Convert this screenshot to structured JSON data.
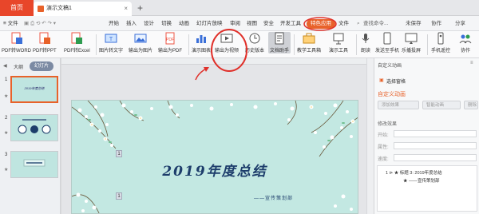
{
  "tabs": {
    "home": "首页",
    "document": "演示文稿1",
    "close": "×",
    "add": "+"
  },
  "menu": {
    "file": "≡ 文件",
    "items": [
      "开始",
      "插入",
      "设计",
      "切换",
      "动画",
      "幻灯片放映",
      "审阅",
      "视图",
      "安全",
      "开发工具"
    ],
    "highlight": "特色应用",
    "after": "文件",
    "search": "查找命令...",
    "unsaved": "未保存",
    "collab": "协作",
    "share": "分享"
  },
  "ribbon": {
    "items": [
      {
        "label": "PDF转WORD",
        "icon": "pdf-to-word-icon"
      },
      {
        "label": "PDF转PPT",
        "icon": "pdf-to-ppt-icon"
      },
      {
        "label": "PDF转Excel",
        "icon": "pdf-to-excel-icon"
      },
      {
        "label": "图片转文字",
        "icon": "image-to-text-icon"
      },
      {
        "label": "输出为图片",
        "icon": "export-image-icon"
      },
      {
        "label": "输出为PDF",
        "icon": "export-pdf-icon"
      },
      {
        "label": "演示图表",
        "icon": "chart-icon"
      },
      {
        "label": "输出为视频",
        "icon": "export-video-icon"
      },
      {
        "label": "历史版本",
        "icon": "history-icon"
      },
      {
        "label": "文档助手",
        "icon": "doc-assistant-icon"
      },
      {
        "label": "教学工具箱",
        "icon": "teaching-toolbox-icon"
      },
      {
        "label": "演示工具",
        "icon": "presentation-tools-icon"
      },
      {
        "label": "朗读",
        "icon": "read-aloud-icon"
      },
      {
        "label": "发送至手机",
        "icon": "send-to-phone-icon"
      },
      {
        "label": "乐播投屏",
        "icon": "cast-screen-icon"
      },
      {
        "label": "手机遥控",
        "icon": "remote-control-icon"
      },
      {
        "label": "协作",
        "icon": "collaborate-icon"
      }
    ]
  },
  "leftpanel": {
    "tab_outline": "大纲",
    "tab_slides": "幻灯片",
    "slides": [
      {
        "number": "1",
        "star": "★",
        "title": "2019年度总结"
      },
      {
        "number": "2",
        "star": "★",
        "title": ""
      },
      {
        "number": "3",
        "star": "★",
        "title": ""
      }
    ]
  },
  "slide": {
    "title": "2019年度总结",
    "subtitle": "——宣传策划部",
    "marker1": "1",
    "marker2": "1"
  },
  "rightpanel": {
    "header": "自定义动画",
    "select_pane": "选择窗格",
    "custom_anim": "自定义动画",
    "add_effect": "添加效果",
    "smart_anim": "智能动画",
    "delete": "删除",
    "modify": "修改效果",
    "start": "开始:",
    "property": "属性:",
    "speed": "速度:",
    "list_item1": "1  ⊳  ★  标题 3: 2019年度总结",
    "list_item2": "★  ——宣传策划部"
  }
}
